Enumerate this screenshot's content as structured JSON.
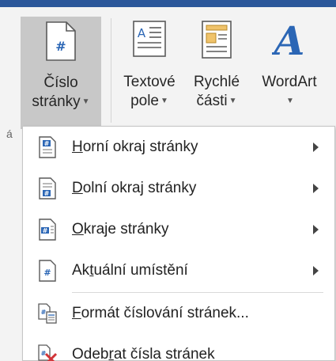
{
  "ribbon": {
    "page_number": {
      "line1": "Číslo",
      "line2": "stránky"
    },
    "text_box": {
      "line1": "Textové",
      "line2": "pole"
    },
    "quick_parts": {
      "line1": "Rychlé",
      "line2": "části"
    },
    "wordart": {
      "line1": "WordArt"
    },
    "cut_group_hint": "á"
  },
  "menu": {
    "items": [
      {
        "pre": "",
        "ul": "H",
        "post": "orní okraj stránky",
        "has_submenu": true
      },
      {
        "pre": "",
        "ul": "D",
        "post": "olní okraj stránky",
        "has_submenu": true
      },
      {
        "pre": "",
        "ul": "O",
        "post": "kraje stránky",
        "has_submenu": true
      },
      {
        "pre": "Ak",
        "ul": "t",
        "post": "uální umístění",
        "has_submenu": true
      },
      {
        "pre": "",
        "ul": "F",
        "post": "ormát číslování stránek...",
        "has_submenu": false
      },
      {
        "pre": "Odeb",
        "ul": "r",
        "post": "at čísla stránek",
        "has_submenu": false
      }
    ]
  },
  "colors": {
    "accent": "#2b579a",
    "icon_blue": "#2b66b5",
    "delete_red": "#d13438",
    "wordart_blue": "#2b66b5"
  },
  "icons": [
    "page-number-icon",
    "text-box-icon",
    "quick-parts-icon",
    "wordart-icon",
    "header-page-number-icon",
    "footer-page-number-icon",
    "margins-page-number-icon",
    "current-position-icon",
    "format-page-numbers-icon",
    "remove-page-numbers-icon"
  ]
}
